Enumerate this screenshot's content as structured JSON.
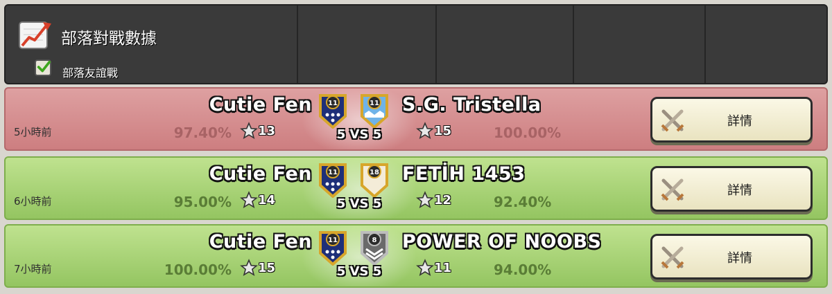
{
  "header": {
    "title": "部落對戰數據",
    "friendly_filter_label": "部落友誼戰",
    "friendly_filter_checked": true
  },
  "wars": [
    {
      "result": "lose",
      "time_ago": "5小時前",
      "vs_label": "5 VS 5",
      "details_label": "詳情",
      "home": {
        "name": "Cutie Fen",
        "level": "11",
        "stars": "13",
        "destruction": "97.40%"
      },
      "away": {
        "name": "S.G. Tristella",
        "level": "11",
        "stars": "15",
        "destruction": "100.00%"
      }
    },
    {
      "result": "win",
      "time_ago": "6小時前",
      "vs_label": "5 VS 5",
      "details_label": "詳情",
      "home": {
        "name": "Cutie Fen",
        "level": "11",
        "stars": "14",
        "destruction": "95.00%"
      },
      "away": {
        "name": "FETİH 1453",
        "level": "18",
        "stars": "12",
        "destruction": "92.40%"
      }
    },
    {
      "result": "win",
      "time_ago": "7小時前",
      "vs_label": "5 VS 5",
      "details_label": "詳情",
      "home": {
        "name": "Cutie Fen",
        "level": "11",
        "stars": "15",
        "destruction": "100.00%"
      },
      "away": {
        "name": "POWER OF NOOBS",
        "level": "8",
        "stars": "11",
        "destruction": "94.00%"
      }
    }
  ],
  "colors": {
    "lose_row": "#d99294",
    "win_row": "#a8d475",
    "header_bg": "#3a3a3a"
  },
  "icons": {
    "header": "rising-chart-icon",
    "checkbox": "checkmark-icon",
    "star": "star-icon",
    "details": "crossed-swords-icon"
  }
}
